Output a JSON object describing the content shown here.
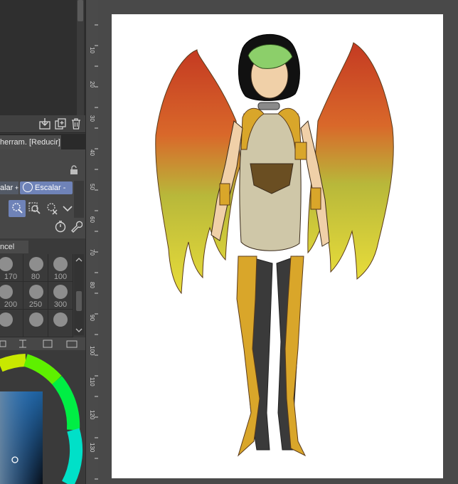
{
  "panel": {
    "tab_label": "herram. [Reducir]",
    "transform_left": "alar",
    "transform_arrow": "▾",
    "transform_scale": "Escalar",
    "brush_title": "ncel",
    "brush_sizes": [
      "170",
      "80",
      "100",
      "200",
      "250",
      "300",
      "",
      "",
      ""
    ]
  },
  "ruler": {
    "marks": [
      "10",
      "20",
      "30",
      "40",
      "50",
      "60",
      "70",
      "80",
      "90",
      "100",
      "110",
      "120",
      "130"
    ]
  },
  "colors": {
    "accent": "#6f83b8",
    "panel_bg": "#3a3a3a",
    "canvas_bg": "#494949",
    "paper": "#ffffff"
  },
  "icons": {
    "toolbar": [
      "import-icon",
      "copy-layer-icon",
      "trash-icon"
    ],
    "tools": [
      "lasso-select-icon",
      "magnify-select-icon",
      "lasso-remove-icon",
      "chevron-down-icon"
    ],
    "options": [
      "stopwatch-icon",
      "wrench-icon"
    ]
  }
}
